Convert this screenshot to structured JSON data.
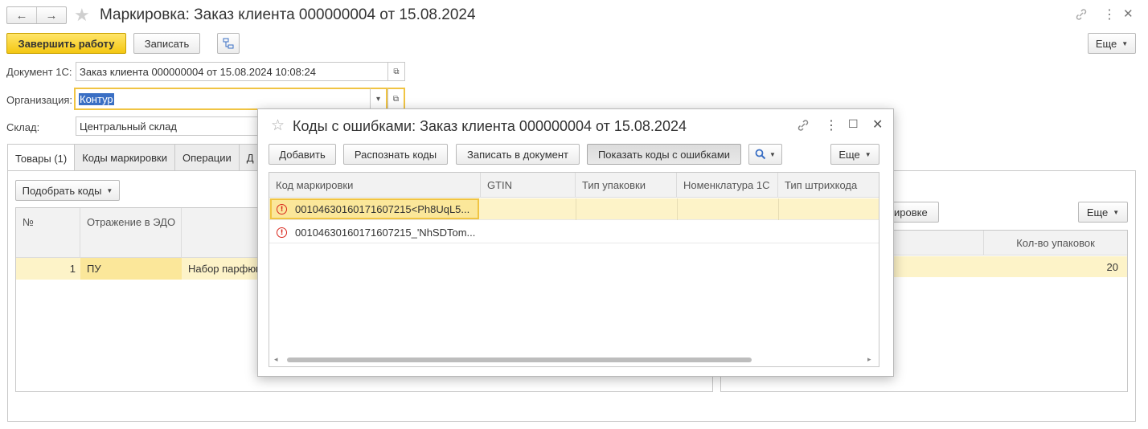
{
  "window": {
    "nav_back": "←",
    "nav_forward": "→",
    "star": "★",
    "title": "Маркировка: Заказ клиента 000000004 от 15.08.2024",
    "link_icon": "🔗",
    "more_icon": "⋮",
    "close_icon": "✕"
  },
  "toolbar": {
    "finish": "Завершить работу",
    "save": "Записать",
    "structure_icon": "⊞",
    "more": "Еще"
  },
  "form": {
    "doc_label": "Документ 1С:",
    "doc_value": "Заказ клиента 000000004 от 15.08.2024 10:08:24",
    "org_label": "Организация:",
    "org_value": "Контур",
    "wh_label": "Склад:",
    "wh_value": "Центральный склад",
    "open_icon": "⧉",
    "dropdown_icon": "▾"
  },
  "tabs": [
    "Товары (1)",
    "Коды маркировки",
    "Операции",
    "Д"
  ],
  "goods": {
    "pick_codes": "Подобрать коды",
    "columns": [
      "№",
      "Отражение в ЭДО",
      ""
    ],
    "rows": [
      {
        "n": "1",
        "edo": "ПУ",
        "name": "Набор парфюм"
      }
    ]
  },
  "right_panel": {
    "btn_partial": "ировке",
    "more": "Еще",
    "col_qty": "Кол-во упаковок",
    "qty_value": "20"
  },
  "dialog": {
    "title": "Коды с ошибками: Заказ клиента 000000004 от 15.08.2024",
    "star": "☆",
    "link_icon": "🔗",
    "more_icon": "⋮",
    "maximize_icon": "☐",
    "close_icon": "✕",
    "buttons": {
      "add": "Добавить",
      "recognize": "Распознать коды",
      "write": "Записать в документ",
      "show_errors": "Показать коды с ошибками",
      "search_icon": "🔍",
      "more": "Еще"
    },
    "columns": [
      "Код маркировки",
      "GTIN",
      "Тип упаковки",
      "Номенклатура 1С",
      "Тип штрихкода"
    ],
    "rows": [
      {
        "code": "0010463016017160721​5<Ph8UqL5...",
        "gtin": "",
        "pack": "",
        "nom": "",
        "bar": ""
      },
      {
        "code": "00104630160171607215_'NhSDTom...",
        "gtin": "",
        "pack": "",
        "nom": "",
        "bar": ""
      }
    ],
    "error_icon": "!",
    "scroll_left": "◂",
    "scroll_right": "▸"
  },
  "colors": {
    "accent_yellow": "#f4c712",
    "selection_row": "#fdf3c8",
    "error_red": "#d9261c",
    "highlight_blue": "#3a6fc4"
  }
}
